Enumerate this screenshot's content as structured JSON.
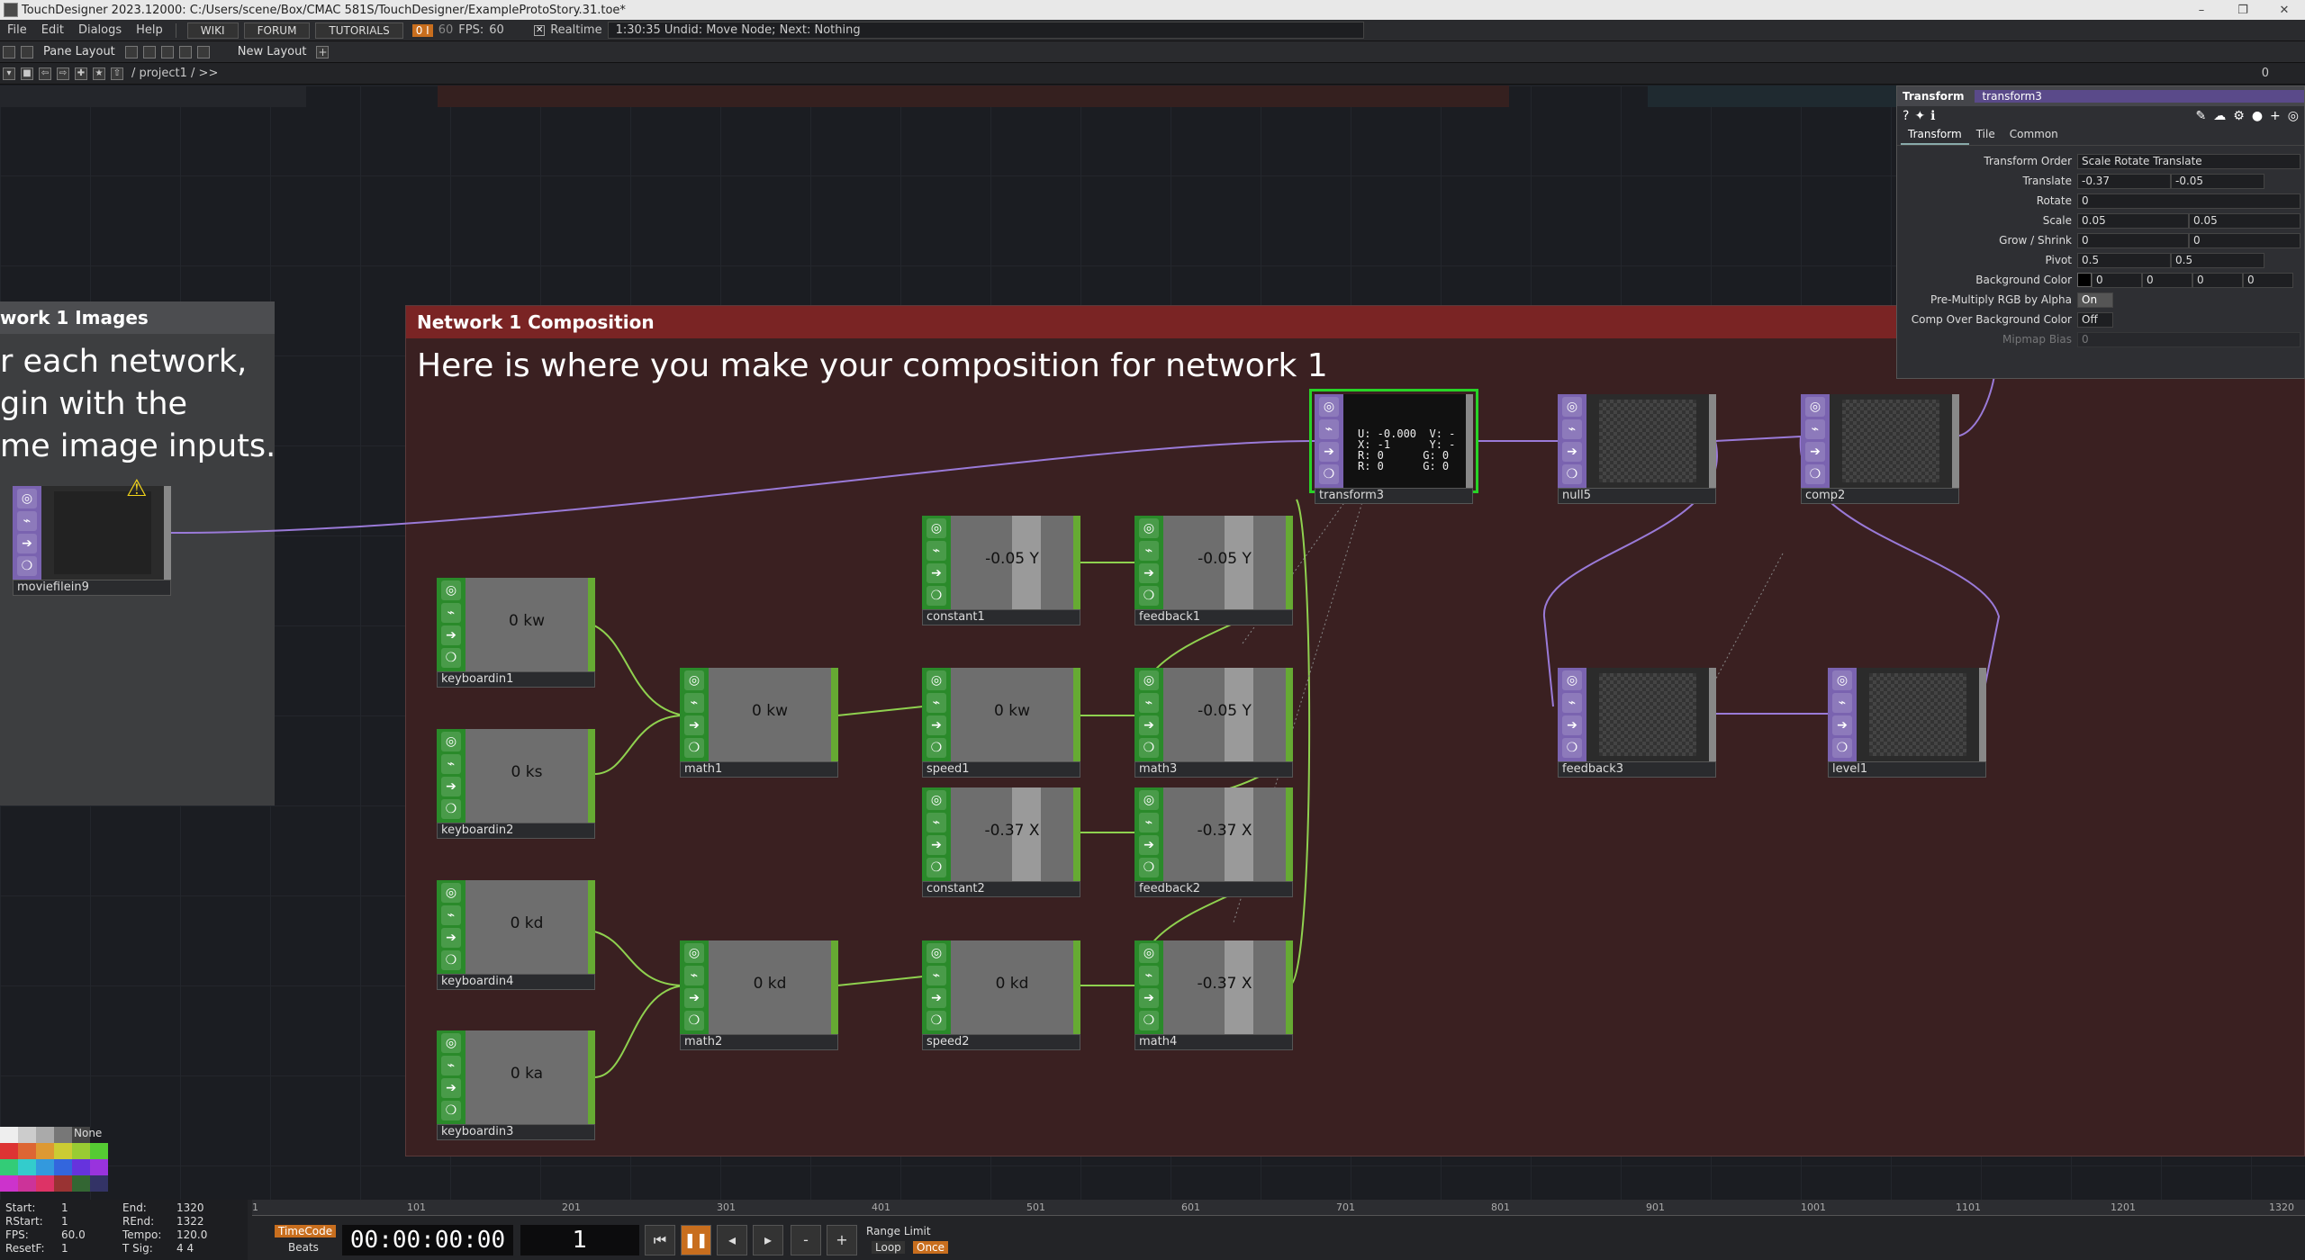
{
  "window": {
    "title": "TouchDesigner 2023.12000: C:/Users/scene/Box/CMAC 581S/TouchDesigner/ExampleProtoStory.31.toe*",
    "controls": [
      "–",
      "❐",
      "✕"
    ]
  },
  "menu": {
    "items": [
      "File",
      "Edit",
      "Dialogs",
      "Help"
    ],
    "wiki": "WIKI",
    "forum": "FORUM",
    "tutorials": "TUTORIALS",
    "fps_box": "0 I",
    "fps_dim": "60",
    "fps_label": "FPS:",
    "fps_value": "60",
    "realtime": "Realtime",
    "status": "1:30:35 Undid: Move Node; Next: Nothing"
  },
  "panebar": {
    "pane_layout": "Pane Layout",
    "new_layout": "New Layout",
    "plus": "+"
  },
  "pathbar": {
    "path": "/ project1 / >>",
    "right": "0"
  },
  "images_box": {
    "title": "work 1 Images",
    "lines": [
      "r each network,",
      "gin with the",
      "me image inputs."
    ]
  },
  "composition_box": {
    "title": "Network 1 Composition",
    "subtitle": "Here is where you make your composition for network 1"
  },
  "nodes": {
    "moviefilein9": "moviefilein9",
    "keyboardin1": {
      "label": "keyboardin1",
      "value": "0 kw"
    },
    "keyboardin2": {
      "label": "keyboardin2",
      "value": "0 ks"
    },
    "keyboardin4": {
      "label": "keyboardin4",
      "value": "0 kd"
    },
    "keyboardin3": {
      "label": "keyboardin3",
      "value": "0 ka"
    },
    "math1": {
      "label": "math1",
      "value": "0 kw"
    },
    "math2": {
      "label": "math2",
      "value": "0 kd"
    },
    "speed1": {
      "label": "speed1",
      "value": "0 kw"
    },
    "speed2": {
      "label": "speed2",
      "value": "0 kd"
    },
    "constant1": {
      "label": "constant1",
      "value": "-0.05 Y"
    },
    "constant2": {
      "label": "constant2",
      "value": "-0.37 X"
    },
    "feedback1": {
      "label": "feedback1",
      "value": "-0.05 Y"
    },
    "feedback2": {
      "label": "feedback2",
      "value": "-0.37 X"
    },
    "math3": {
      "label": "math3",
      "value": "-0.05 Y"
    },
    "math4": {
      "label": "math4",
      "value": "-0.37 X"
    },
    "transform3": {
      "label": "transform3",
      "info": "U: -0.000  V: -\nX: -1      Y: -\nR: 0      G: 0\nR: 0      G: 0"
    },
    "null5": "null5",
    "comp2": "comp2",
    "feedback3": "feedback3",
    "level1": "level1"
  },
  "params": {
    "type": "Transform",
    "name": "transform3",
    "tabs": [
      "Transform",
      "Tile",
      "Common"
    ],
    "rows": [
      {
        "label": "Transform Order",
        "values": [
          "Scale Rotate Translate"
        ]
      },
      {
        "label": "Translate",
        "values": [
          "-0.37",
          "-0.05"
        ]
      },
      {
        "label": "Rotate",
        "values": [
          "0"
        ]
      },
      {
        "label": "Scale",
        "values": [
          "0.05",
          "0.05"
        ]
      },
      {
        "label": "Grow / Shrink",
        "values": [
          "0",
          "0"
        ]
      },
      {
        "label": "Pivot",
        "values": [
          "0.5",
          "0.5"
        ]
      },
      {
        "label": "Background Color",
        "values": [
          "0",
          "0",
          "0",
          "0"
        ]
      },
      {
        "label": "Pre-Multiply RGB by Alpha",
        "values": [
          "On"
        ]
      },
      {
        "label": "Comp Over Background Color",
        "values": [
          "Off"
        ]
      },
      {
        "label": "Mipmap Bias",
        "values": [
          "0"
        ]
      }
    ]
  },
  "palette": {
    "none": "None"
  },
  "timeline": {
    "ticks": [
      "1",
      "101",
      "201",
      "301",
      "401",
      "501",
      "601",
      "701",
      "801",
      "901",
      "1001",
      "1101",
      "1201",
      "1320"
    ],
    "stats": {
      "start_l": "Start:",
      "start": "1",
      "end_l": "End:",
      "end": "1320",
      "rstart_l": "RStart:",
      "rstart": "1",
      "rend_l": "REnd:",
      "rend": "1322",
      "fps_l": "FPS:",
      "fps": "60.0",
      "tempo_l": "Tempo:",
      "tempo": "120.0",
      "resetf_l": "ResetF:",
      "resetf": "1",
      "tsig_l": "T Sig:",
      "tsig": "4    4"
    },
    "timecode_btn": "TimeCode",
    "beats_btn": "Beats",
    "timecode": "00:00:00:00",
    "frame": "1",
    "range_limit": "Range Limit",
    "loop": "Loop",
    "once": "Once"
  },
  "colors": {
    "accent": "#c86e1e",
    "select": "#27d327",
    "chop": "#2a8a2a",
    "top": "#7a63b0"
  }
}
